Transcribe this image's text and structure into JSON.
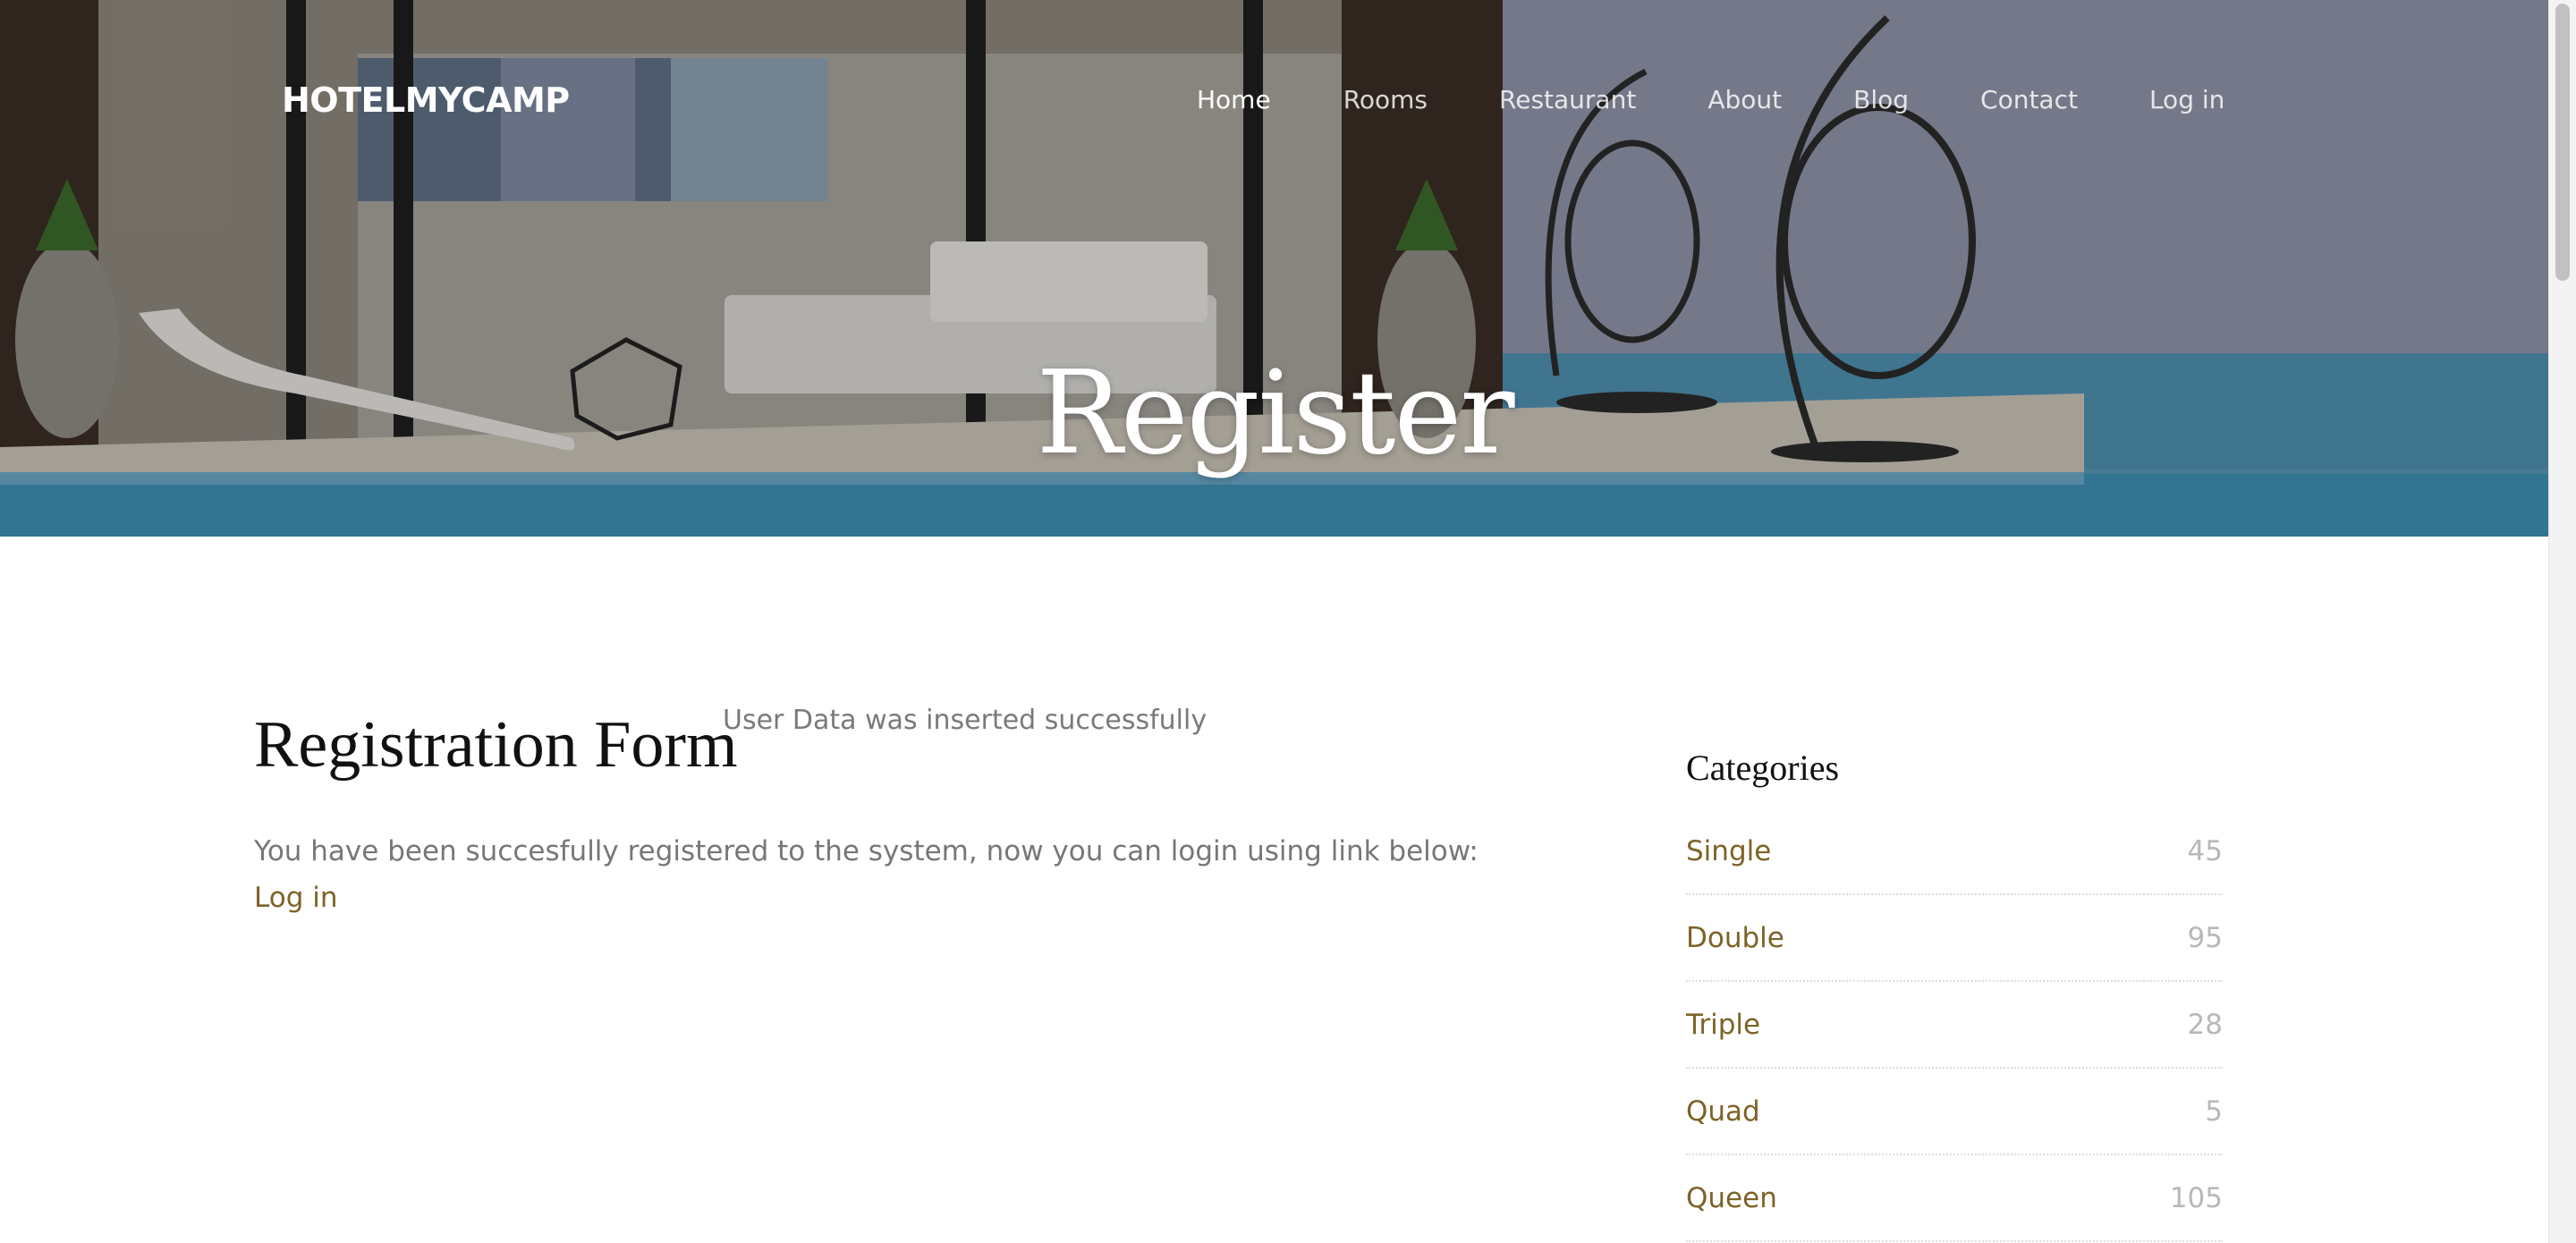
{
  "header": {
    "brand": "HOTELMYCAMP",
    "nav": [
      {
        "label": "Home",
        "active": true
      },
      {
        "label": "Rooms",
        "active": false
      },
      {
        "label": "Restaurant",
        "active": false
      },
      {
        "label": "About",
        "active": false
      },
      {
        "label": "Blog",
        "active": false
      },
      {
        "label": "Contact",
        "active": false
      },
      {
        "label": "Log in",
        "active": false
      }
    ],
    "hero_title": "Register"
  },
  "main": {
    "form_title": "Registration Form",
    "flash_message": "User Data was inserted successfully",
    "notice": "You have been succesfully registered to the system, now you can login using link below:",
    "login_link": "Log in"
  },
  "sidebar": {
    "title": "Categories",
    "categories": [
      {
        "name": "Single",
        "count": "45"
      },
      {
        "name": "Double",
        "count": "95"
      },
      {
        "name": "Triple",
        "count": "28"
      },
      {
        "name": "Quad",
        "count": "5"
      },
      {
        "name": "Queen",
        "count": "105"
      }
    ]
  },
  "colors": {
    "accent": "#7d6327",
    "muted_text": "#777777",
    "count_text": "#b8b8b8"
  }
}
